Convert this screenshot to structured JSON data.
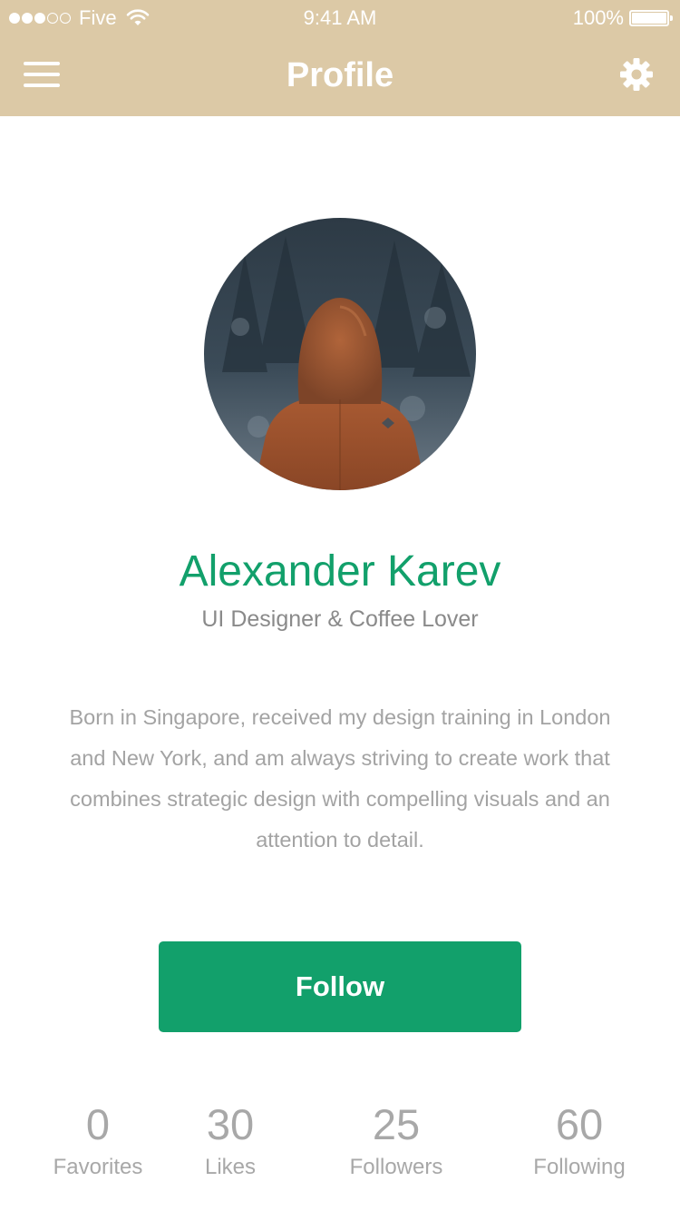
{
  "status_bar": {
    "carrier": "Five",
    "time": "9:41 AM",
    "battery": "100%",
    "signal_bars_filled": 3,
    "signal_bars_total": 5
  },
  "nav": {
    "title": "Profile",
    "menu_icon": "hamburger-menu-icon",
    "settings_icon": "gear-icon"
  },
  "profile": {
    "name": "Alexander Karev",
    "subtitle": "UI Designer & Coffee Lover",
    "bio": "Born in Singapore, received my design training in London and New York, and am always striving to create work that combines strategic design with compelling visuals and an attention to detail.",
    "follow_label": "Follow"
  },
  "stats": [
    {
      "value": "0",
      "label": "Favorites"
    },
    {
      "value": "30",
      "label": "Likes"
    },
    {
      "value": "25",
      "label": "Followers"
    },
    {
      "value": "60",
      "label": "Following"
    }
  ],
  "colors": {
    "header": "#dcc9a6",
    "accent": "#12a06b",
    "muted_text": "#a8a8a8"
  }
}
